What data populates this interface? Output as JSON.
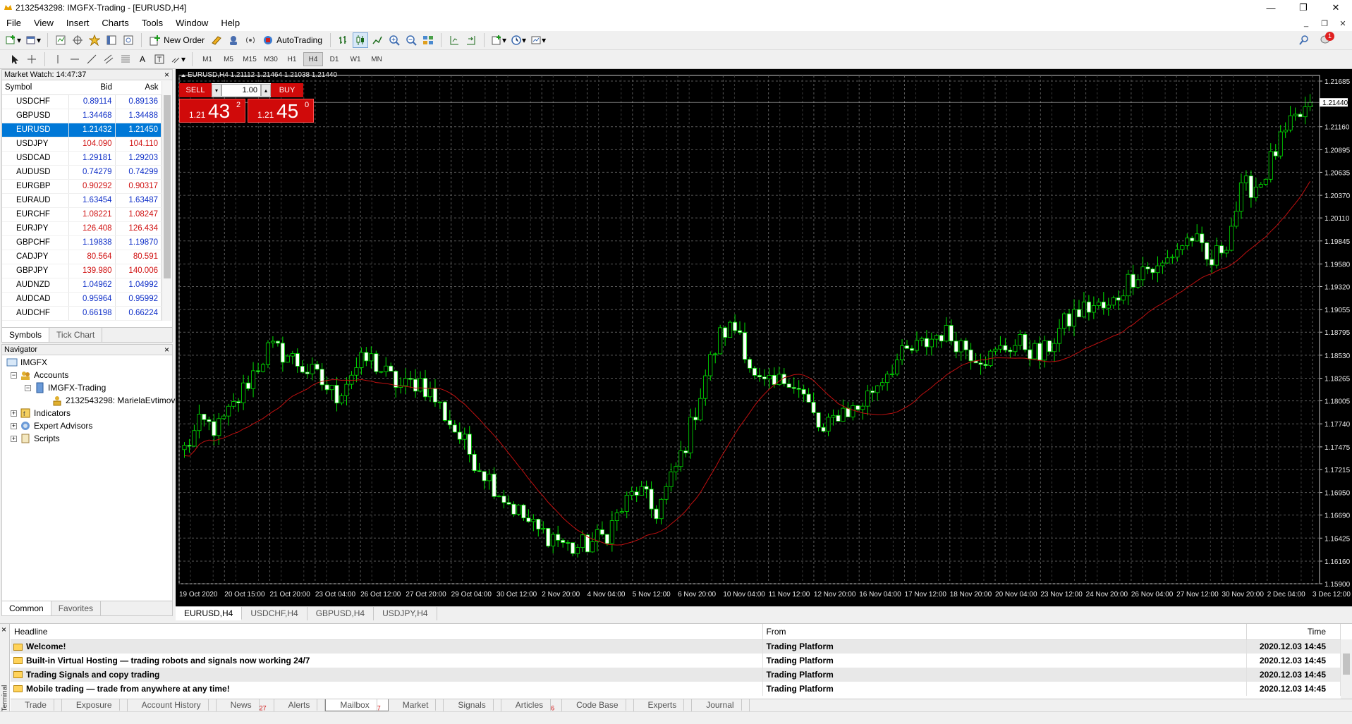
{
  "window": {
    "title": "2132543298: IMGFX-Trading - [EURUSD,H4]",
    "controls": [
      "—",
      "❐",
      "✕"
    ]
  },
  "menu": [
    "File",
    "View",
    "Insert",
    "Charts",
    "Tools",
    "Window",
    "Help"
  ],
  "mdi_controls": [
    "_",
    "❐",
    "✕"
  ],
  "toolbar": {
    "new_order": "New Order",
    "autotrading": "AutoTrading",
    "notification_count": "1"
  },
  "timeframes": [
    "M1",
    "M5",
    "M15",
    "M30",
    "H1",
    "H4",
    "D1",
    "W1",
    "MN"
  ],
  "active_timeframe": "H4",
  "market_watch": {
    "title": "Market Watch: 14:47:37",
    "columns": [
      "Symbol",
      "Bid",
      "Ask"
    ],
    "rows": [
      {
        "symbol": "USDCHF",
        "bid": "0.89114",
        "ask": "0.89136",
        "dir": "up"
      },
      {
        "symbol": "GBPUSD",
        "bid": "1.34468",
        "ask": "1.34488",
        "dir": "up"
      },
      {
        "symbol": "EURUSD",
        "bid": "1.21432",
        "ask": "1.21450",
        "dir": "up",
        "selected": true
      },
      {
        "symbol": "USDJPY",
        "bid": "104.090",
        "ask": "104.110",
        "dir": "dn"
      },
      {
        "symbol": "USDCAD",
        "bid": "1.29181",
        "ask": "1.29203",
        "dir": "up"
      },
      {
        "symbol": "AUDUSD",
        "bid": "0.74279",
        "ask": "0.74299",
        "dir": "up"
      },
      {
        "symbol": "EURGBP",
        "bid": "0.90292",
        "ask": "0.90317",
        "dir": "dn"
      },
      {
        "symbol": "EURAUD",
        "bid": "1.63454",
        "ask": "1.63487",
        "dir": "up"
      },
      {
        "symbol": "EURCHF",
        "bid": "1.08221",
        "ask": "1.08247",
        "dir": "dn"
      },
      {
        "symbol": "EURJPY",
        "bid": "126.408",
        "ask": "126.434",
        "dir": "dn"
      },
      {
        "symbol": "GBPCHF",
        "bid": "1.19838",
        "ask": "1.19870",
        "dir": "up"
      },
      {
        "symbol": "CADJPY",
        "bid": "80.564",
        "ask": "80.591",
        "dir": "dn"
      },
      {
        "symbol": "GBPJPY",
        "bid": "139.980",
        "ask": "140.006",
        "dir": "dn"
      },
      {
        "symbol": "AUDNZD",
        "bid": "1.04962",
        "ask": "1.04992",
        "dir": "up"
      },
      {
        "symbol": "AUDCAD",
        "bid": "0.95964",
        "ask": "0.95992",
        "dir": "up"
      },
      {
        "symbol": "AUDCHF",
        "bid": "0.66198",
        "ask": "0.66224",
        "dir": "up"
      }
    ],
    "tabs": [
      "Symbols",
      "Tick Chart"
    ],
    "colors": {
      "up": "#1030c8",
      "down": "#d01010",
      "up_icon": "#2ca02c",
      "down_icon": "#e06010"
    }
  },
  "navigator": {
    "title": "Navigator",
    "root": "IMGFX",
    "accounts": "Accounts",
    "server": "IMGFX-Trading",
    "account": "2132543298: MarielaEvtimov",
    "indicators": "Indicators",
    "expert_advisors": "Expert Advisors",
    "scripts": "Scripts",
    "tabs": [
      "Common",
      "Favorites"
    ]
  },
  "chart": {
    "header": "EURUSD,H4  1.21112 1.21464 1.21038 1.21440",
    "current_price": "1.21440",
    "one_click": {
      "sell": "SELL",
      "buy": "BUY",
      "lot": "1.00",
      "sell_prefix": "1.21",
      "sell_big": "43",
      "sell_sup": "2",
      "buy_prefix": "1.21",
      "buy_big": "45",
      "buy_sup": "0"
    },
    "tabs": [
      "EURUSD,H4",
      "USDCHF,H4",
      "GBPUSD,H4",
      "USDJPY,H4"
    ],
    "colors": {
      "background": "#000000",
      "grid": "#5a5a5a",
      "candle": "#00e000",
      "bull_body": "#000000",
      "bear_body": "#ffffff",
      "ma": "#c01010",
      "trade_red": "#d00a0a"
    }
  },
  "chart_data": {
    "type": "candlestick",
    "symbol": "EURUSD",
    "timeframe": "H4",
    "ylim": [
      1.159,
      1.2175
    ],
    "y_ticks": [
      "1.21685",
      "1.21160",
      "1.20895",
      "1.20635",
      "1.20370",
      "1.20110",
      "1.19845",
      "1.19580",
      "1.19320",
      "1.19055",
      "1.18795",
      "1.18530",
      "1.18265",
      "1.18005",
      "1.17740",
      "1.17475",
      "1.17215",
      "1.16950",
      "1.16690",
      "1.16425",
      "1.16160",
      "1.15900"
    ],
    "x_ticks": [
      "19 Oct 2020",
      "20 Oct 15:00",
      "21 Oct 20:00",
      "23 Oct 04:00",
      "26 Oct 12:00",
      "27 Oct 20:00",
      "29 Oct 04:00",
      "30 Oct 12:00",
      "2 Nov 20:00",
      "4 Nov 04:00",
      "5 Nov 12:00",
      "6 Nov 20:00",
      "10 Nov 04:00",
      "11 Nov 12:00",
      "12 Nov 20:00",
      "16 Nov 04:00",
      "17 Nov 12:00",
      "18 Nov 20:00",
      "20 Nov 04:00",
      "23 Nov 12:00",
      "24 Nov 20:00",
      "26 Nov 04:00",
      "27 Nov 12:00",
      "30 Nov 20:00",
      "2 Dec 04:00",
      "3 Dec 12:00"
    ],
    "close_path": [
      1.1745,
      1.1775,
      1.1768,
      1.1795,
      1.183,
      1.186,
      1.1855,
      1.184,
      1.1825,
      1.1805,
      1.1835,
      1.185,
      1.183,
      1.1815,
      1.1825,
      1.18,
      1.177,
      1.174,
      1.1715,
      1.169,
      1.167,
      1.165,
      1.1645,
      1.163,
      1.1635,
      1.1645,
      1.1675,
      1.17,
      1.167,
      1.171,
      1.176,
      1.183,
      1.188,
      1.1885,
      1.182,
      1.1815,
      1.183,
      1.18,
      1.176,
      1.179,
      1.179,
      1.1815,
      1.184,
      1.1855,
      1.1865,
      1.188,
      1.187,
      1.1855,
      1.185,
      1.1865,
      1.1865,
      1.185,
      1.188,
      1.19,
      1.191,
      1.1905,
      1.1935,
      1.1955,
      1.195,
      1.1975,
      1.199,
      1.1955,
      1.1985,
      1.2045,
      1.205,
      1.209,
      1.212,
      1.214
    ]
  },
  "terminal": {
    "side_label": "Terminal",
    "columns": [
      "Headline",
      "From",
      "Time"
    ],
    "rows": [
      {
        "headline": "Welcome!",
        "from": "Trading Platform",
        "time": "2020.12.03 14:45"
      },
      {
        "headline": "Built-in Virtual Hosting — trading robots and signals now working 24/7",
        "from": "Trading Platform",
        "time": "2020.12.03 14:45"
      },
      {
        "headline": "Trading Signals and copy trading",
        "from": "Trading Platform",
        "time": "2020.12.03 14:45"
      },
      {
        "headline": "Mobile trading — trade from anywhere at any time!",
        "from": "Trading Platform",
        "time": "2020.12.03 14:45"
      }
    ],
    "tabs": [
      {
        "label": "Trade",
        "badge": ""
      },
      {
        "label": "Exposure",
        "badge": ""
      },
      {
        "label": "Account History",
        "badge": ""
      },
      {
        "label": "News",
        "badge": "27"
      },
      {
        "label": "Alerts",
        "badge": ""
      },
      {
        "label": "Mailbox",
        "badge": "7"
      },
      {
        "label": "Market",
        "badge": ""
      },
      {
        "label": "Signals",
        "badge": ""
      },
      {
        "label": "Articles",
        "badge": "6"
      },
      {
        "label": "Code Base",
        "badge": ""
      },
      {
        "label": "Experts",
        "badge": ""
      },
      {
        "label": "Journal",
        "badge": ""
      }
    ],
    "active_tab": "Mailbox"
  }
}
